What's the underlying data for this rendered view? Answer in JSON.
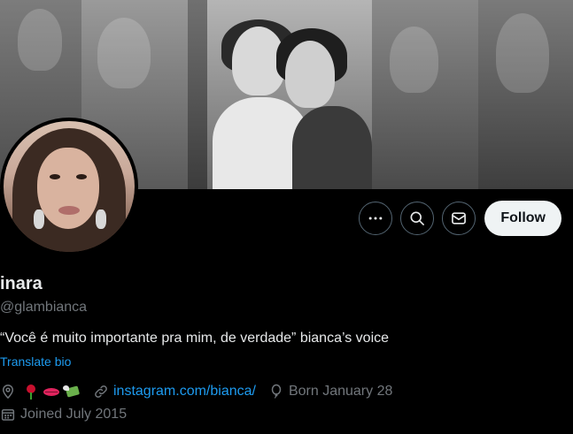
{
  "profile": {
    "name": "inara",
    "handle": "@glambianca",
    "bio": "“Você é muito importante pra mim, de verdade” bianca’s voice",
    "translate_label": "Translate bio",
    "location_emojis": [
      "rose",
      "lips",
      "money-with-wings"
    ],
    "website": "instagram.com/bianca/",
    "birth": "Born January 28",
    "joined": "Joined July 2015"
  },
  "actions": {
    "more_icon": "more-horizontal-icon",
    "search_icon": "search-icon",
    "message_icon": "envelope-icon",
    "follow_label": "Follow"
  },
  "colors": {
    "background": "#000000",
    "primary_text": "#e7e9ea",
    "secondary_text": "#71767b",
    "link": "#1d9bf0",
    "follow_button_bg": "#eff3f4",
    "follow_button_text": "#0f1419",
    "icon_button_border": "#536471"
  }
}
